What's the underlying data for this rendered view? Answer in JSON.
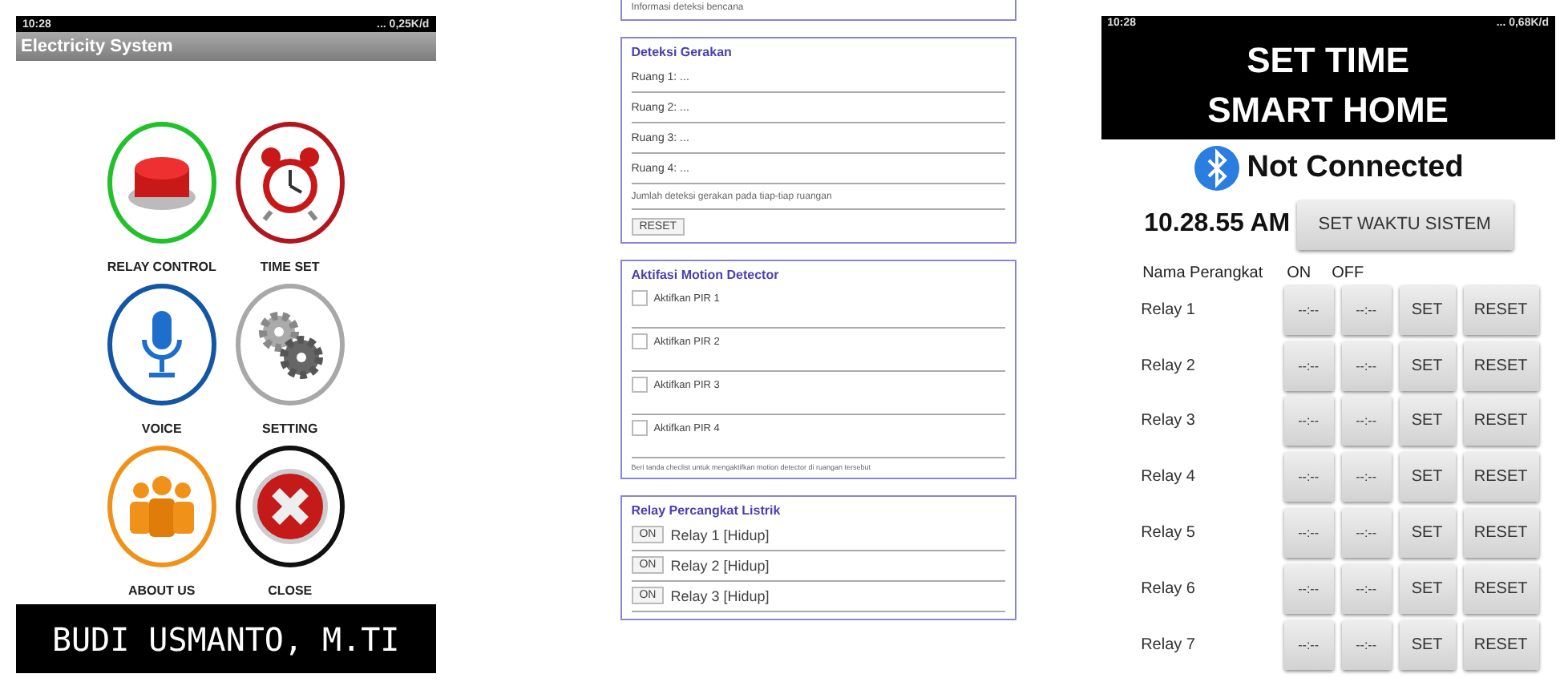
{
  "menu_app": {
    "status_bar": {
      "time": "10:28",
      "network": "... 0,25K/d"
    },
    "title": "Electricity System",
    "items": [
      {
        "kind": "push",
        "label": "RELAY CONTROL",
        "color": "#22c02a"
      },
      {
        "kind": "clock",
        "label": "TIME SET",
        "color": "#b0161c"
      },
      {
        "kind": "mic",
        "label": "VOICE",
        "color": "#1456a6"
      },
      {
        "kind": "gears",
        "label": "SETTING",
        "color": "#a8a8a8"
      },
      {
        "kind": "people",
        "label": "ABOUT US",
        "color": "#f0921a"
      },
      {
        "kind": "close",
        "label": "CLOSE",
        "color": "#111111"
      }
    ],
    "footer": "BUDI USMANTO, M.TI"
  },
  "web_app": {
    "top_note": "Informasi deteksi bencana",
    "motion": {
      "title": "Deteksi Gerakan",
      "rooms": [
        "Ruang 1: ...",
        "Ruang 2: ...",
        "Ruang 3: ...",
        "Ruang 4: ..."
      ],
      "note": "Jumlah deteksi gerakan pada tiap-tiap ruangan",
      "reset": "RESET"
    },
    "pir": {
      "title": "Aktifasi Motion Detector",
      "items": [
        {
          "label": "Aktifkan PIR 1",
          "checked": false
        },
        {
          "label": "Aktifkan PIR 2",
          "checked": false
        },
        {
          "label": "Aktifkan PIR 3",
          "checked": false
        },
        {
          "label": "Aktifkan PIR 4",
          "checked": false
        }
      ],
      "note": "Beri tanda checlist untuk mengaktifkan motion detector di ruangan tersebut"
    },
    "relays": {
      "title": "Relay Percangkat Listrik",
      "items": [
        {
          "button": "ON",
          "label": "Relay 1 [Hidup]"
        },
        {
          "button": "ON",
          "label": "Relay 2 [Hidup]"
        },
        {
          "button": "ON",
          "label": "Relay 3 [Hidup]"
        }
      ]
    }
  },
  "time_app": {
    "status_bar": {
      "time": "10:28",
      "network": "... 0,68K/d"
    },
    "header": [
      "SET TIME",
      "SMART HOME"
    ],
    "connection": "Not Connected",
    "clock": "10.28.55 AM",
    "sync_button": "SET WAKTU SISTEM",
    "columns": [
      "Nama Perangkat",
      "ON",
      "OFF"
    ],
    "relays": [
      {
        "name": "Relay 1",
        "on": "--:--",
        "off": "--:--",
        "set": "SET",
        "reset": "RESET"
      },
      {
        "name": "Relay 2",
        "on": "--:--",
        "off": "--:--",
        "set": "SET",
        "reset": "RESET"
      },
      {
        "name": "Relay 3",
        "on": "--:--",
        "off": "--:--",
        "set": "SET",
        "reset": "RESET"
      },
      {
        "name": "Relay 4",
        "on": "--:--",
        "off": "--:--",
        "set": "SET",
        "reset": "RESET"
      },
      {
        "name": "Relay 5",
        "on": "--:--",
        "off": "--:--",
        "set": "SET",
        "reset": "RESET"
      },
      {
        "name": "Relay 6",
        "on": "--:--",
        "off": "--:--",
        "set": "SET",
        "reset": "RESET"
      },
      {
        "name": "Relay 7",
        "on": "--:--",
        "off": "--:--",
        "set": "SET",
        "reset": "RESET"
      }
    ]
  }
}
